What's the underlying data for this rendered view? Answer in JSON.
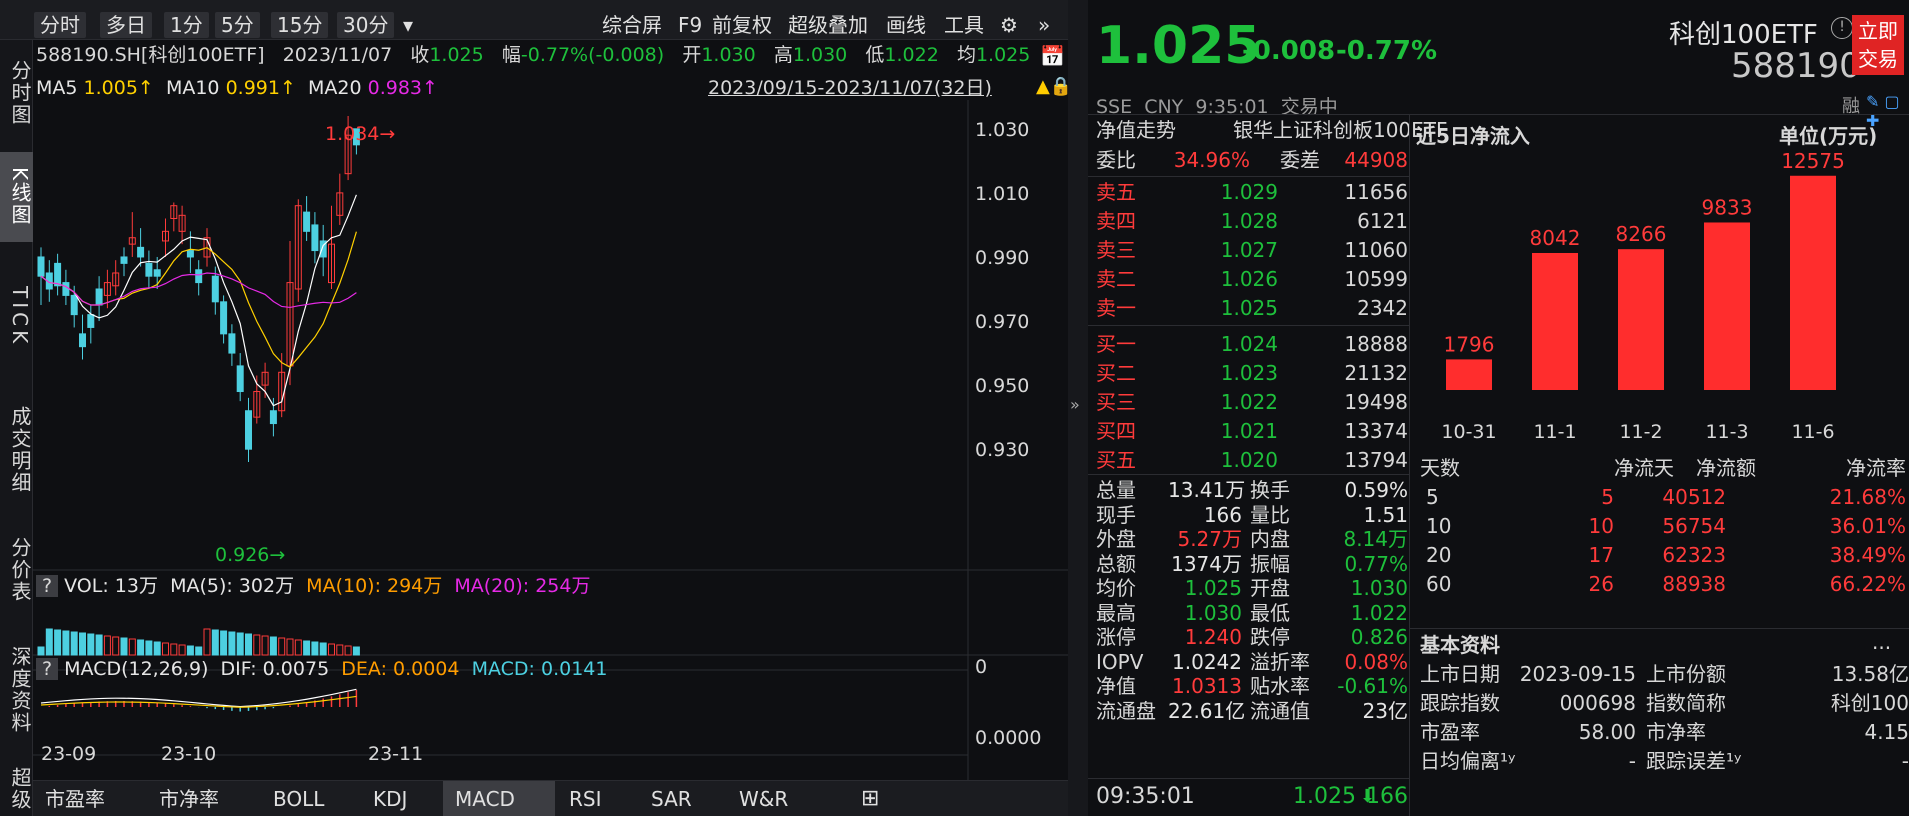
{
  "toolbar": {
    "items": [
      "分时",
      "多日",
      "1分",
      "5分",
      "15分",
      "30分"
    ],
    "dropdown": "▾",
    "right": [
      "综合屏",
      "F9",
      "前复权",
      "超级叠加",
      "画线",
      "工具"
    ]
  },
  "left_nav": [
    "分时图",
    "K线图",
    "TICK",
    "成交明细",
    "分价表",
    "深度资料",
    "超级"
  ],
  "info1": {
    "code": "588190.SH[科创100ETF]",
    "date": "2023/11/07",
    "close_label": "收",
    "close": "1.025",
    "range_label": "幅",
    "range": "-0.77%(-0.008)",
    "open_label": "开",
    "open": "1.030",
    "high_label": "高",
    "high": "1.030",
    "low_label": "低",
    "low": "1.022",
    "avg_label": "均",
    "avg": "1.025"
  },
  "info2": {
    "ma5_label": "MA5",
    "ma5": "1.005↑",
    "ma10_label": "MA10",
    "ma10": "0.991↑",
    "ma20_label": "MA20",
    "ma20": "0.983↑",
    "period": "2023/09/15-2023/11/07(32日)"
  },
  "kline": {
    "y_ticks": [
      "1.030",
      "1.010",
      "0.990",
      "0.970",
      "0.950",
      "0.930"
    ],
    "max_label": "1.034→",
    "min_label": "0.926→",
    "x_ticks": [
      "23-09",
      "23-10",
      "23-11"
    ]
  },
  "vol": {
    "q": "?",
    "label": "VOL: 13万",
    "ma5": "MA(5): 302万",
    "ma10": "MA(10): 294万",
    "ma20": "MA(20): 254万",
    "axis": "0"
  },
  "macd": {
    "q": "?",
    "label": "MACD(12,26,9)",
    "dif": "DIF: 0.0075",
    "dea": "DEA: 0.0004",
    "macd": "MACD: 0.0141",
    "axis": "0.0000"
  },
  "subtabs": [
    "市盈率",
    "市净率",
    "BOLL",
    "KDJ",
    "MACD",
    "RSI",
    "SAR",
    "W&R",
    "⊞"
  ],
  "quote": {
    "price": "1.025",
    "change": "-0.008",
    "pct": "-0.77%",
    "name": "科创100ETF",
    "code": "588190",
    "trade_btn": "立即\n交易",
    "exch": "SSE  CNY  9:35:01  交易中",
    "icons": "融",
    "nav_title": "净值走势",
    "fund_name": "银华上证科创板100ETF",
    "weibi_label": "委比",
    "weibi": "34.96%",
    "weicha_label": "委差",
    "weicha": "44908",
    "asks": [
      [
        "卖五",
        "1.029",
        "11656"
      ],
      [
        "卖四",
        "1.028",
        "6121"
      ],
      [
        "卖三",
        "1.027",
        "11060"
      ],
      [
        "卖二",
        "1.026",
        "10599"
      ],
      [
        "卖一",
        "1.025",
        "2342"
      ]
    ],
    "bids": [
      [
        "买一",
        "1.024",
        "18888"
      ],
      [
        "买二",
        "1.023",
        "21132"
      ],
      [
        "买三",
        "1.022",
        "19498"
      ],
      [
        "买四",
        "1.021",
        "13374"
      ],
      [
        "买五",
        "1.020",
        "13794"
      ]
    ],
    "stats": [
      [
        "总量",
        "13.41万",
        "换手",
        "0.59%"
      ],
      [
        "现手",
        "166",
        "量比",
        "1.51"
      ],
      [
        "外盘",
        "5.27万",
        "内盘",
        "8.14万"
      ],
      [
        "总额",
        "1374万",
        "振幅",
        "0.77%"
      ],
      [
        "均价",
        "1.025",
        "开盘",
        "1.030"
      ],
      [
        "最高",
        "1.030",
        "最低",
        "1.022"
      ],
      [
        "涨停",
        "1.240",
        "跌停",
        "0.826"
      ],
      [
        "IOPV",
        "1.0242",
        "溢折率",
        "0.08%"
      ],
      [
        "净值",
        "1.0313",
        "贴水率",
        "-0.61%"
      ],
      [
        "流通盘",
        "22.61亿",
        "流通值",
        "23亿"
      ]
    ],
    "last_tick": {
      "time": "09:35:01",
      "price": "1.025",
      "arrow": "⬇",
      "vol": "166"
    }
  },
  "flow": {
    "title": "近5日净流入",
    "unit": "单位(万元)",
    "headers": [
      "天数",
      "净流天",
      "净流额",
      "净流率"
    ],
    "rows": [
      [
        "5",
        "5",
        "40512",
        "21.68%"
      ],
      [
        "10",
        "10",
        "56754",
        "36.01%"
      ],
      [
        "20",
        "17",
        "62323",
        "38.49%"
      ],
      [
        "60",
        "26",
        "88938",
        "66.22%"
      ]
    ]
  },
  "chart_data": {
    "type": "bar",
    "categories": [
      "10-31",
      "11-1",
      "11-2",
      "11-3",
      "11-6"
    ],
    "values": [
      1796,
      8042,
      8266,
      9833,
      12575
    ],
    "title": "近5日净流入",
    "unit": "单位(万元)"
  },
  "basic": {
    "title": "基本资料",
    "more": "...",
    "rows": [
      [
        "上市日期",
        "2023-09-15",
        "上市份额",
        "13.58亿"
      ],
      [
        "跟踪指数",
        "000698",
        "指数简称",
        "科创100"
      ],
      [
        "市盈率",
        "58.00",
        "市净率",
        "4.15"
      ],
      [
        "日均偏离¹ʸ",
        "-",
        "跟踪误差¹ʸ",
        "-"
      ]
    ]
  },
  "colors": {
    "up": "#ff3b3b",
    "down": "#1ec03c",
    "bar_up": "#ff2d2d",
    "cyan": "#4dd0e1"
  }
}
